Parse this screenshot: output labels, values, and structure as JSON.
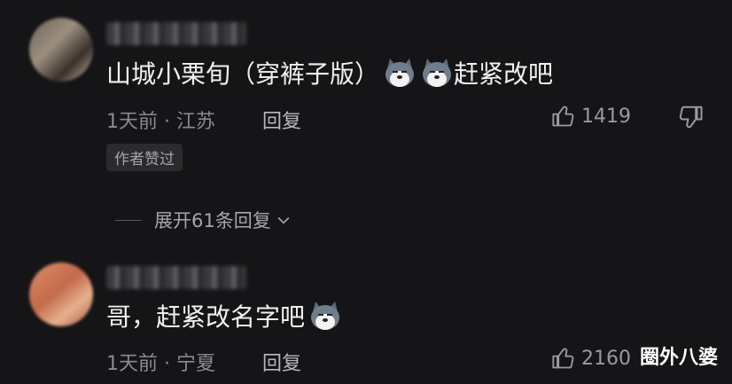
{
  "comments": [
    {
      "text": "山城小栗旬（穿裤子版）",
      "text_suffix": "赶紧改吧",
      "emoji_count": 2,
      "emoji_icon": "husky-emoji",
      "time_location": "1天前 · 江苏",
      "reply_label": "回复",
      "likes": "1419",
      "badge": "作者赞过"
    },
    {
      "text": "哥，赶紧改名字吧",
      "emoji_count": 1,
      "emoji_icon": "husky-emoji",
      "time_location": "1天前 · 宁夏",
      "reply_label": "回复",
      "likes": "2160"
    }
  ],
  "expand_replies": "展开61条回复",
  "watermark": "圈外八婆",
  "colors": {
    "background": "#151517",
    "text": "#f1f1f1",
    "meta": "#8a8a8f"
  }
}
